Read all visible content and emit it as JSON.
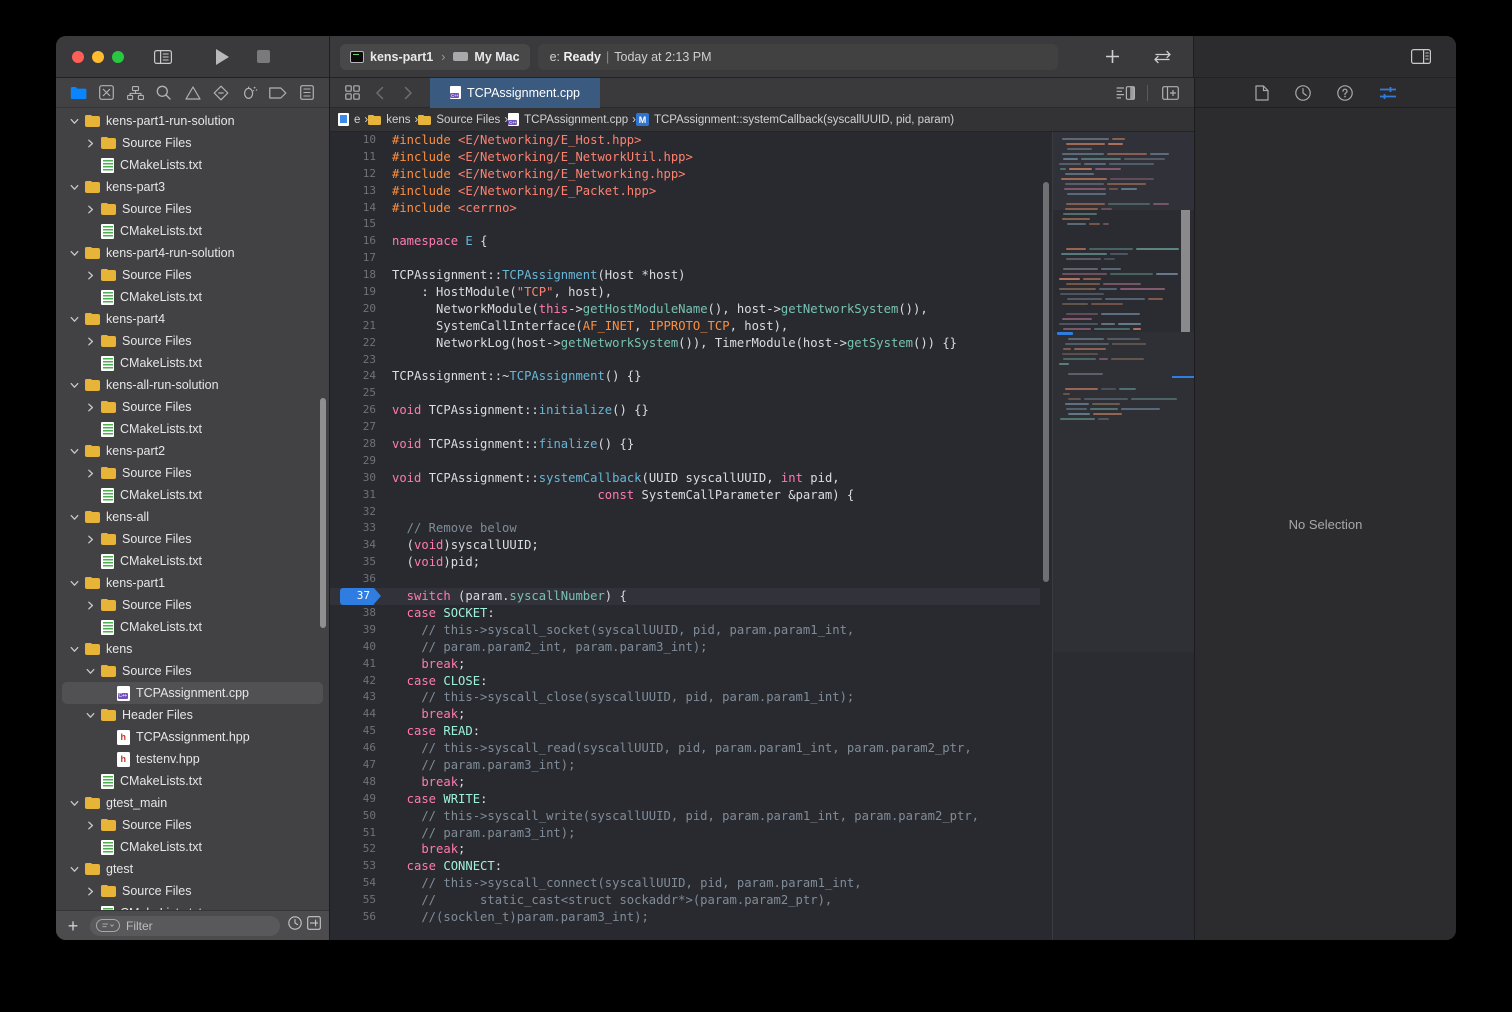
{
  "window": {
    "title": "Xcode",
    "traffic_lights": [
      "close",
      "minimize",
      "zoom"
    ]
  },
  "toolbar": {
    "scheme_name": "kens-part1",
    "scheme_separator": "›",
    "destination": "My Mac",
    "status_prefix": "e:",
    "status_state": "Ready",
    "status_pipe": "|",
    "status_time": "Today at 2:13 PM",
    "add_button": "+",
    "swap_button": "⇄"
  },
  "navigator": {
    "icons": [
      {
        "name": "project-navigator-icon",
        "label": "Project"
      },
      {
        "name": "source-control-navigator-icon",
        "label": "Source Control"
      },
      {
        "name": "symbol-navigator-icon",
        "label": "Symbols"
      },
      {
        "name": "find-navigator-icon",
        "label": "Find"
      },
      {
        "name": "issue-navigator-icon",
        "label": "Issues"
      },
      {
        "name": "test-navigator-icon",
        "label": "Tests"
      },
      {
        "name": "debug-navigator-icon",
        "label": "Debug"
      },
      {
        "name": "breakpoint-navigator-icon",
        "label": "Breakpoints"
      },
      {
        "name": "report-navigator-icon",
        "label": "Reports"
      }
    ],
    "filter": {
      "placeholder": "Filter",
      "add_label": "+"
    },
    "tree": [
      {
        "label": "kens-part1-run-solution",
        "type": "folder",
        "indent": 1,
        "twisty": "open"
      },
      {
        "label": "Source Files",
        "type": "folder",
        "indent": 2,
        "twisty": "closed"
      },
      {
        "label": "CMakeLists.txt",
        "type": "txt",
        "indent": 2,
        "twisty": "none"
      },
      {
        "label": "kens-part3",
        "type": "folder",
        "indent": 1,
        "twisty": "open"
      },
      {
        "label": "Source Files",
        "type": "folder",
        "indent": 2,
        "twisty": "closed"
      },
      {
        "label": "CMakeLists.txt",
        "type": "txt",
        "indent": 2,
        "twisty": "none"
      },
      {
        "label": "kens-part4-run-solution",
        "type": "folder",
        "indent": 1,
        "twisty": "open"
      },
      {
        "label": "Source Files",
        "type": "folder",
        "indent": 2,
        "twisty": "closed"
      },
      {
        "label": "CMakeLists.txt",
        "type": "txt",
        "indent": 2,
        "twisty": "none"
      },
      {
        "label": "kens-part4",
        "type": "folder",
        "indent": 1,
        "twisty": "open"
      },
      {
        "label": "Source Files",
        "type": "folder",
        "indent": 2,
        "twisty": "closed"
      },
      {
        "label": "CMakeLists.txt",
        "type": "txt",
        "indent": 2,
        "twisty": "none"
      },
      {
        "label": "kens-all-run-solution",
        "type": "folder",
        "indent": 1,
        "twisty": "open"
      },
      {
        "label": "Source Files",
        "type": "folder",
        "indent": 2,
        "twisty": "closed"
      },
      {
        "label": "CMakeLists.txt",
        "type": "txt",
        "indent": 2,
        "twisty": "none"
      },
      {
        "label": "kens-part2",
        "type": "folder",
        "indent": 1,
        "twisty": "open"
      },
      {
        "label": "Source Files",
        "type": "folder",
        "indent": 2,
        "twisty": "closed"
      },
      {
        "label": "CMakeLists.txt",
        "type": "txt",
        "indent": 2,
        "twisty": "none"
      },
      {
        "label": "kens-all",
        "type": "folder",
        "indent": 1,
        "twisty": "open"
      },
      {
        "label": "Source Files",
        "type": "folder",
        "indent": 2,
        "twisty": "closed"
      },
      {
        "label": "CMakeLists.txt",
        "type": "txt",
        "indent": 2,
        "twisty": "none"
      },
      {
        "label": "kens-part1",
        "type": "folder",
        "indent": 1,
        "twisty": "open"
      },
      {
        "label": "Source Files",
        "type": "folder",
        "indent": 2,
        "twisty": "closed"
      },
      {
        "label": "CMakeLists.txt",
        "type": "txt",
        "indent": 2,
        "twisty": "none"
      },
      {
        "label": "kens",
        "type": "folder",
        "indent": 1,
        "twisty": "open"
      },
      {
        "label": "Source Files",
        "type": "folder",
        "indent": 2,
        "twisty": "open"
      },
      {
        "label": "TCPAssignment.cpp",
        "type": "cpp",
        "indent": 3,
        "twisty": "none",
        "selected": true
      },
      {
        "label": "Header Files",
        "type": "folder",
        "indent": 2,
        "twisty": "open"
      },
      {
        "label": "TCPAssignment.hpp",
        "type": "hpp",
        "indent": 3,
        "twisty": "none"
      },
      {
        "label": "testenv.hpp",
        "type": "hpp",
        "indent": 3,
        "twisty": "none"
      },
      {
        "label": "CMakeLists.txt",
        "type": "txt",
        "indent": 2,
        "twisty": "none"
      },
      {
        "label": "gtest_main",
        "type": "folder",
        "indent": 1,
        "twisty": "open"
      },
      {
        "label": "Source Files",
        "type": "folder",
        "indent": 2,
        "twisty": "closed"
      },
      {
        "label": "CMakeLists.txt",
        "type": "txt",
        "indent": 2,
        "twisty": "none"
      },
      {
        "label": "gtest",
        "type": "folder",
        "indent": 1,
        "twisty": "open"
      },
      {
        "label": "Source Files",
        "type": "folder",
        "indent": 2,
        "twisty": "closed"
      },
      {
        "label": "CMakeLists.txt",
        "type": "txt",
        "indent": 2,
        "twisty": "none"
      }
    ]
  },
  "editor": {
    "tab_label": "TCPAssignment.cpp",
    "breadcrumb": [
      {
        "label": "e",
        "icon": "project-icon"
      },
      {
        "label": "kens",
        "icon": "folder-icon"
      },
      {
        "label": "Source Files",
        "icon": "folder-icon"
      },
      {
        "label": "TCPAssignment.cpp",
        "icon": "cpp-file-icon"
      },
      {
        "label": "TCPAssignment::systemCallback(syscallUUID, pid, param)",
        "icon": "method-icon"
      }
    ],
    "current_line": 37,
    "first_visible_line": 10,
    "lines": [
      {
        "n": 10,
        "tokens": [
          [
            "pre",
            "#include "
          ],
          [
            "str",
            "<E/Networking/E_Host.hpp>"
          ]
        ]
      },
      {
        "n": 11,
        "tokens": [
          [
            "pre",
            "#include "
          ],
          [
            "str",
            "<E/Networking/E_NetworkUtil.hpp>"
          ]
        ]
      },
      {
        "n": 12,
        "tokens": [
          [
            "pre",
            "#include "
          ],
          [
            "str",
            "<E/Networking/E_Networking.hpp>"
          ]
        ]
      },
      {
        "n": 13,
        "tokens": [
          [
            "pre",
            "#include "
          ],
          [
            "str",
            "<E/Networking/E_Packet.hpp>"
          ]
        ]
      },
      {
        "n": 14,
        "tokens": [
          [
            "pre",
            "#include "
          ],
          [
            "str",
            "<cerrno>"
          ]
        ]
      },
      {
        "n": 15,
        "tokens": []
      },
      {
        "n": 16,
        "tokens": [
          [
            "kw",
            "namespace"
          ],
          [
            "id",
            " "
          ],
          [
            "fn",
            "E"
          ],
          [
            "id",
            " {"
          ]
        ]
      },
      {
        "n": 17,
        "tokens": []
      },
      {
        "n": 18,
        "tokens": [
          [
            "id",
            "TCPAssignment::"
          ],
          [
            "fn",
            "TCPAssignment"
          ],
          [
            "id",
            "(Host *host)"
          ]
        ]
      },
      {
        "n": 19,
        "tokens": [
          [
            "id",
            "    : HostModule("
          ],
          [
            "str",
            "\"TCP\""
          ],
          [
            "id",
            ", host),"
          ]
        ]
      },
      {
        "n": 20,
        "tokens": [
          [
            "id",
            "      NetworkModule("
          ],
          [
            "kw",
            "this"
          ],
          [
            "id",
            "->"
          ],
          [
            "prop",
            "getHostModuleName"
          ],
          [
            "id",
            "(), host->"
          ],
          [
            "prop",
            "getNetworkSystem"
          ],
          [
            "id",
            "()),"
          ]
        ]
      },
      {
        "n": 21,
        "tokens": [
          [
            "id",
            "      SystemCallInterface("
          ],
          [
            "pre",
            "AF_INET"
          ],
          [
            "id",
            ", "
          ],
          [
            "pre",
            "IPPROTO_TCP"
          ],
          [
            "id",
            ", host),"
          ]
        ]
      },
      {
        "n": 22,
        "tokens": [
          [
            "id",
            "      NetworkLog(host->"
          ],
          [
            "prop",
            "getNetworkSystem"
          ],
          [
            "id",
            "()), TimerModule(host->"
          ],
          [
            "prop",
            "getSystem"
          ],
          [
            "id",
            "()) {}"
          ]
        ]
      },
      {
        "n": 23,
        "tokens": []
      },
      {
        "n": 24,
        "tokens": [
          [
            "id",
            "TCPAssignment::~"
          ],
          [
            "fn",
            "TCPAssignment"
          ],
          [
            "id",
            "() {}"
          ]
        ]
      },
      {
        "n": 25,
        "tokens": []
      },
      {
        "n": 26,
        "tokens": [
          [
            "kw",
            "void"
          ],
          [
            "id",
            " TCPAssignment::"
          ],
          [
            "fn",
            "initialize"
          ],
          [
            "id",
            "() {}"
          ]
        ]
      },
      {
        "n": 27,
        "tokens": []
      },
      {
        "n": 28,
        "tokens": [
          [
            "kw",
            "void"
          ],
          [
            "id",
            " TCPAssignment::"
          ],
          [
            "fn",
            "finalize"
          ],
          [
            "id",
            "() {}"
          ]
        ]
      },
      {
        "n": 29,
        "tokens": []
      },
      {
        "n": 30,
        "tokens": [
          [
            "kw",
            "void"
          ],
          [
            "id",
            " TCPAssignment::"
          ],
          [
            "fn",
            "systemCallback"
          ],
          [
            "id",
            "(UUID syscallUUID, "
          ],
          [
            "kw",
            "int"
          ],
          [
            "id",
            " pid,"
          ]
        ]
      },
      {
        "n": 31,
        "tokens": [
          [
            "id",
            "                            "
          ],
          [
            "kw",
            "const"
          ],
          [
            "id",
            " SystemCallParameter &param) {"
          ]
        ]
      },
      {
        "n": 32,
        "tokens": []
      },
      {
        "n": 33,
        "tokens": [
          [
            "cm",
            "  // Remove below"
          ]
        ]
      },
      {
        "n": 34,
        "tokens": [
          [
            "id",
            "  ("
          ],
          [
            "kw",
            "void"
          ],
          [
            "id",
            ")syscallUUID;"
          ]
        ]
      },
      {
        "n": 35,
        "tokens": [
          [
            "id",
            "  ("
          ],
          [
            "kw",
            "void"
          ],
          [
            "id",
            ")pid;"
          ]
        ]
      },
      {
        "n": 36,
        "tokens": []
      },
      {
        "n": 37,
        "tokens": [
          [
            "kw",
            "  switch"
          ],
          [
            "id",
            " (param."
          ],
          [
            "prop",
            "syscallNumber"
          ],
          [
            "id",
            ") {"
          ]
        ],
        "current": true
      },
      {
        "n": 38,
        "tokens": [
          [
            "kw",
            "  case"
          ],
          [
            "id",
            " "
          ],
          [
            "enm",
            "SOCKET"
          ],
          [
            "id",
            ":"
          ]
        ]
      },
      {
        "n": 39,
        "tokens": [
          [
            "cm",
            "    // this->syscall_socket(syscallUUID, pid, param.param1_int,"
          ]
        ]
      },
      {
        "n": 40,
        "tokens": [
          [
            "cm",
            "    // param.param2_int, param.param3_int);"
          ]
        ]
      },
      {
        "n": 41,
        "tokens": [
          [
            "kw",
            "    break"
          ],
          [
            "id",
            ";"
          ]
        ]
      },
      {
        "n": 42,
        "tokens": [
          [
            "kw",
            "  case"
          ],
          [
            "id",
            " "
          ],
          [
            "enm",
            "CLOSE"
          ],
          [
            "id",
            ":"
          ]
        ]
      },
      {
        "n": 43,
        "tokens": [
          [
            "cm",
            "    // this->syscall_close(syscallUUID, pid, param.param1_int);"
          ]
        ]
      },
      {
        "n": 44,
        "tokens": [
          [
            "kw",
            "    break"
          ],
          [
            "id",
            ";"
          ]
        ]
      },
      {
        "n": 45,
        "tokens": [
          [
            "kw",
            "  case"
          ],
          [
            "id",
            " "
          ],
          [
            "enm",
            "READ"
          ],
          [
            "id",
            ":"
          ]
        ]
      },
      {
        "n": 46,
        "tokens": [
          [
            "cm",
            "    // this->syscall_read(syscallUUID, pid, param.param1_int, param.param2_ptr,"
          ]
        ]
      },
      {
        "n": 47,
        "tokens": [
          [
            "cm",
            "    // param.param3_int);"
          ]
        ]
      },
      {
        "n": 48,
        "tokens": [
          [
            "kw",
            "    break"
          ],
          [
            "id",
            ";"
          ]
        ]
      },
      {
        "n": 49,
        "tokens": [
          [
            "kw",
            "  case"
          ],
          [
            "id",
            " "
          ],
          [
            "enm",
            "WRITE"
          ],
          [
            "id",
            ":"
          ]
        ]
      },
      {
        "n": 50,
        "tokens": [
          [
            "cm",
            "    // this->syscall_write(syscallUUID, pid, param.param1_int, param.param2_ptr,"
          ]
        ]
      },
      {
        "n": 51,
        "tokens": [
          [
            "cm",
            "    // param.param3_int);"
          ]
        ]
      },
      {
        "n": 52,
        "tokens": [
          [
            "kw",
            "    break"
          ],
          [
            "id",
            ";"
          ]
        ]
      },
      {
        "n": 53,
        "tokens": [
          [
            "kw",
            "  case"
          ],
          [
            "id",
            " "
          ],
          [
            "enm",
            "CONNECT"
          ],
          [
            "id",
            ":"
          ]
        ]
      },
      {
        "n": 54,
        "tokens": [
          [
            "cm",
            "    // this->syscall_connect(syscallUUID, pid, param.param1_int,"
          ]
        ]
      },
      {
        "n": 55,
        "tokens": [
          [
            "cm",
            "    //      static_cast<struct sockaddr*>(param.param2_ptr),"
          ]
        ]
      },
      {
        "n": 56,
        "tokens": [
          [
            "cm",
            "    //(socklen_t)param.param3_int);"
          ]
        ]
      }
    ]
  },
  "inspector": {
    "icons": [
      {
        "name": "file-inspector-icon",
        "selected": false
      },
      {
        "name": "history-inspector-icon",
        "selected": false
      },
      {
        "name": "help-inspector-icon",
        "selected": false
      },
      {
        "name": "attributes-inspector-icon",
        "selected": true
      }
    ],
    "empty_message": "No Selection"
  },
  "colors": {
    "accent": "#2f7de1",
    "tab_active_bg": "#3a5a80",
    "editor_bg": "#292a2f",
    "navigator_bg": "#424244",
    "titlebar_bg": "#3a3a3c",
    "keyword": "#ff7ab2",
    "string": "#ff8170",
    "comment": "#7f8c98",
    "preprocessor": "#fd8f3f",
    "function": "#67b7d8",
    "property": "#78c2b3",
    "enum": "#9ef1dd"
  }
}
